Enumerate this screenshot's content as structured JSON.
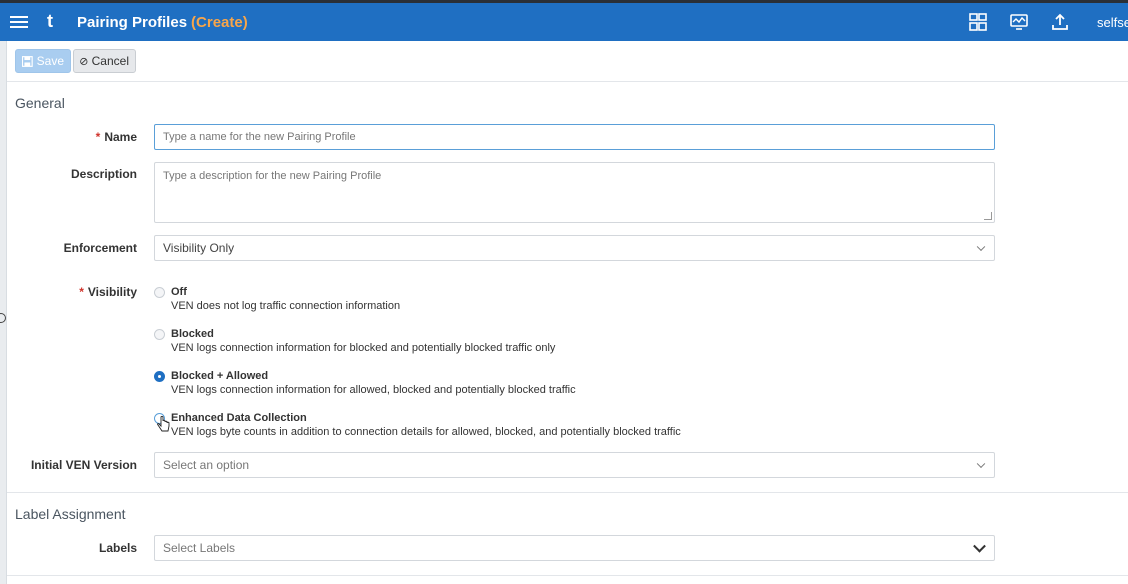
{
  "header": {
    "logo": "t",
    "title": "Pairing Profiles",
    "subtitle": "(Create)",
    "user": "selfse",
    "icons": [
      "dashboard-icon",
      "monitor-icon",
      "upload-icon"
    ]
  },
  "toolbar": {
    "save_label": "Save",
    "cancel_label": "Cancel"
  },
  "general": {
    "title": "General",
    "name": {
      "label": "Name",
      "placeholder": "Type a name for the new Pairing Profile"
    },
    "description": {
      "label": "Description",
      "placeholder": "Type a description for the new Pairing Profile"
    },
    "enforcement": {
      "label": "Enforcement",
      "value": "Visibility Only"
    },
    "visibility": {
      "label": "Visibility",
      "options": [
        {
          "title": "Off",
          "desc": "VEN does not log traffic connection information",
          "selected": false
        },
        {
          "title": "Blocked",
          "desc": "VEN logs connection information for blocked and potentially blocked traffic only",
          "selected": false
        },
        {
          "title": "Blocked + Allowed",
          "desc": "VEN logs connection information for allowed, blocked and potentially blocked traffic",
          "selected": true
        },
        {
          "title": "Enhanced Data Collection",
          "desc": "VEN logs byte counts in addition to connection details for allowed, blocked, and potentially blocked traffic",
          "selected": false
        }
      ]
    },
    "initial_ven": {
      "label": "Initial VEN Version",
      "placeholder": "Select an option"
    }
  },
  "label_assignment": {
    "title": "Label Assignment",
    "labels": {
      "label": "Labels",
      "placeholder": "Select Labels"
    }
  },
  "colors": {
    "primary": "#1f6fc2",
    "accent": "#f7a54a",
    "required": "#d0342c"
  }
}
